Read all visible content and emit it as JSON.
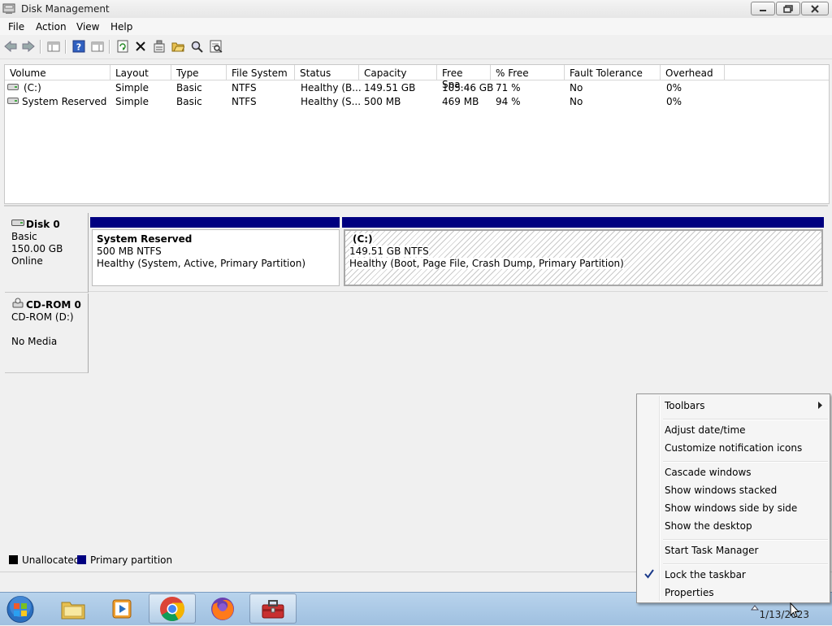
{
  "window": {
    "title": "Disk Management"
  },
  "menu": [
    "File",
    "Action",
    "View",
    "Help"
  ],
  "toolbar_icons": [
    "back-icon",
    "forward-icon",
    "show-hide-console-tree-icon",
    "help-icon",
    "properties-icon",
    "refresh-icon",
    "delete-icon",
    "properties2-icon",
    "open-icon",
    "explore-icon",
    "rescan-icon"
  ],
  "volume_list": {
    "columns": [
      "Volume",
      "Layout",
      "Type",
      "File System",
      "Status",
      "Capacity",
      "Free Spa...",
      "% Free",
      "Fault Tolerance",
      "Overhead"
    ],
    "rows": [
      [
        "(C:)",
        "Simple",
        "Basic",
        "NTFS",
        "Healthy (B...",
        "149.51 GB",
        "105.46 GB",
        "71 %",
        "No",
        "0%"
      ],
      [
        "System Reserved",
        "Simple",
        "Basic",
        "NTFS",
        "Healthy (S...",
        "500 MB",
        "469 MB",
        "94 %",
        "No",
        "0%"
      ]
    ]
  },
  "disks": [
    {
      "name": "Disk 0",
      "type": "Basic",
      "size": "150.00 GB",
      "status": "Online",
      "partitions": [
        {
          "name": "System Reserved",
          "fs": "500 MB NTFS",
          "status": "Healthy (System, Active, Primary Partition)"
        },
        {
          "name": "(C:)",
          "fs": "149.51 GB NTFS",
          "status": "Healthy (Boot, Page File, Crash Dump, Primary Partition)"
        }
      ]
    },
    {
      "name": "CD-ROM 0",
      "type": "CD-ROM (D:)",
      "status": "No Media"
    }
  ],
  "legend": [
    {
      "label": "Unallocated",
      "color": "#000000"
    },
    {
      "label": "Primary partition",
      "color": "#000080"
    }
  ],
  "taskbar": {
    "clock_date": "1/13/2023"
  },
  "context_menu": {
    "items": [
      "Toolbars",
      "Adjust date/time",
      "Customize notification icons",
      "Cascade windows",
      "Show windows stacked",
      "Show windows side by side",
      "Show the desktop",
      "Start Task Manager",
      "Lock the taskbar",
      "Properties"
    ],
    "checked": "Lock the taskbar"
  }
}
